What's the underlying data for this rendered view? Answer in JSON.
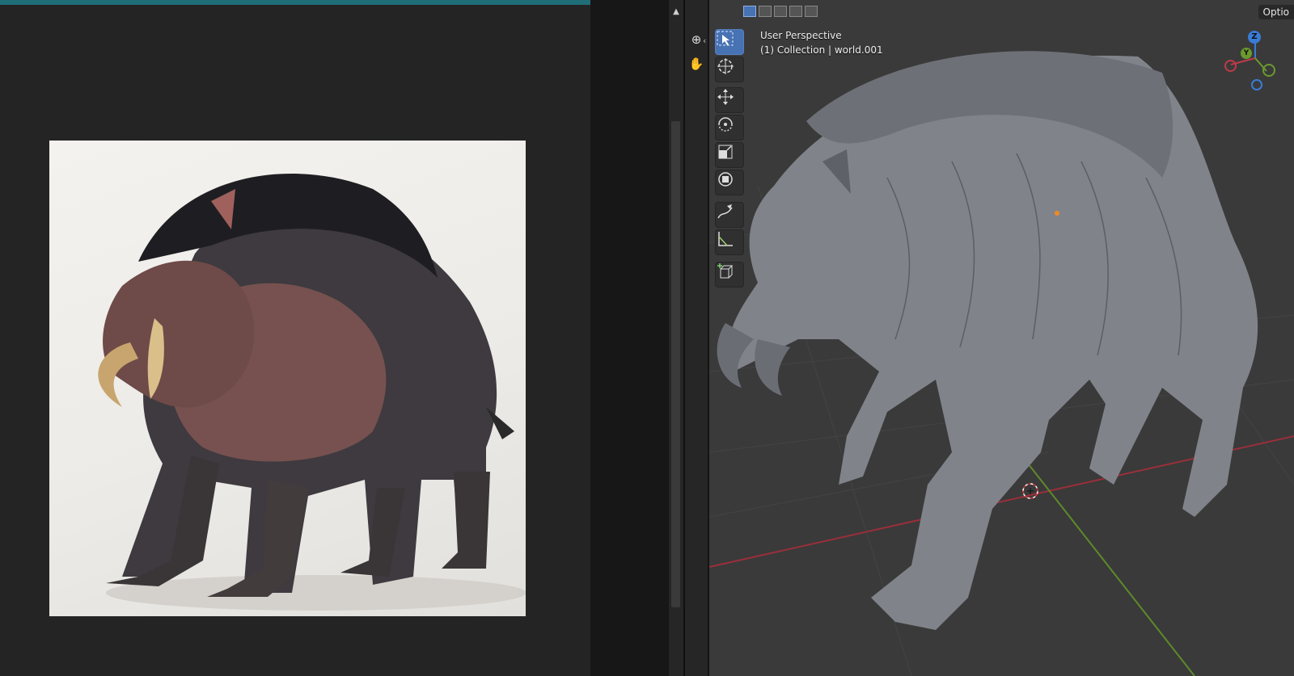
{
  "viewport": {
    "view_name": "User Perspective",
    "collection_info": "(1) Collection | world.001",
    "options_label": "Optio",
    "gizmo": {
      "z_label": "Z",
      "y_label": "Y"
    }
  },
  "toolbar": {
    "tools": [
      "Select Box",
      "Cursor",
      "Move",
      "Rotate",
      "Scale",
      "Transform",
      "Annotate",
      "Measure",
      "Add Cube"
    ],
    "active_tool": "Select Box"
  },
  "select_modes": [
    "set",
    "extend",
    "subtract",
    "intersect",
    "invert"
  ],
  "colors": {
    "accent": "#4772b3",
    "viewport_bg": "#3a3a3a",
    "x_axis": "#c03a48",
    "y_axis": "#6a9a2e",
    "z_axis": "#3a7cd6"
  }
}
